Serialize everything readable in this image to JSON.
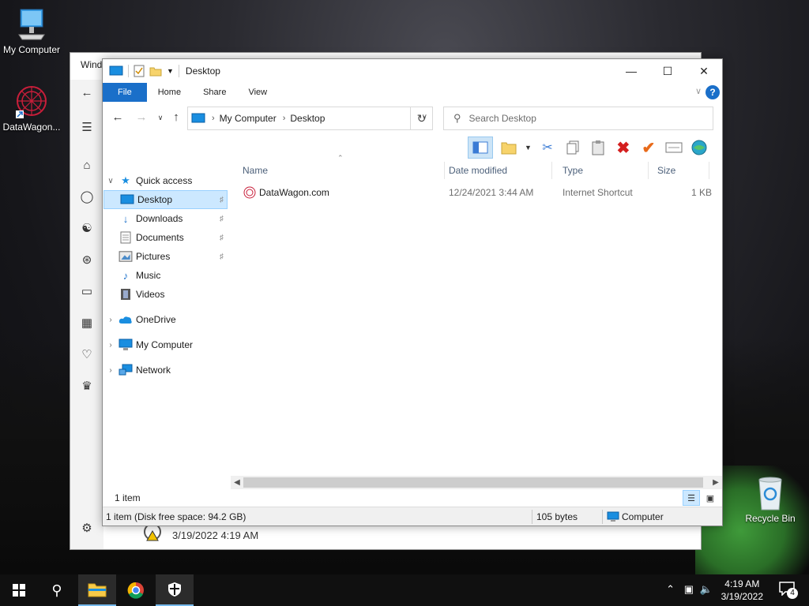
{
  "desktop": {
    "icons": [
      {
        "label": "My Computer",
        "icon": "monitor-icon"
      },
      {
        "label": "DataWagon...",
        "icon": "datawagon-logo-icon"
      },
      {
        "label": "Recycle Bin",
        "icon": "recycle-bin-icon"
      }
    ]
  },
  "background_window": {
    "title": "Wind",
    "footer_time": "3/19/2022 4:19 AM"
  },
  "explorer": {
    "title": "Desktop",
    "ribbon_tabs": {
      "file": "File",
      "home": "Home",
      "share": "Share",
      "view": "View"
    },
    "address": {
      "root": "My Computer",
      "current": "Desktop"
    },
    "search_placeholder": "Search Desktop",
    "nav": {
      "quick_access": "Quick access",
      "desktop": "Desktop",
      "downloads": "Downloads",
      "documents": "Documents",
      "pictures": "Pictures",
      "music": "Music",
      "videos": "Videos",
      "onedrive": "OneDrive",
      "my_computer": "My Computer",
      "network": "Network"
    },
    "columns": {
      "name": "Name",
      "date": "Date modified",
      "type": "Type",
      "size": "Size"
    },
    "files": [
      {
        "name": "DataWagon.com",
        "date": "12/24/2021 3:44 AM",
        "type": "Internet Shortcut",
        "size": "1 KB"
      }
    ],
    "item_count": "1 item",
    "status": {
      "left": "1 item (Disk free space: 94.2 GB)",
      "bytes": "105 bytes",
      "location": "Computer"
    }
  },
  "taskbar": {
    "time": "4:19 AM",
    "date": "3/19/2022",
    "notifications": "4"
  },
  "colors": {
    "accent": "#1a6fc9",
    "selection": "#cce8ff"
  }
}
